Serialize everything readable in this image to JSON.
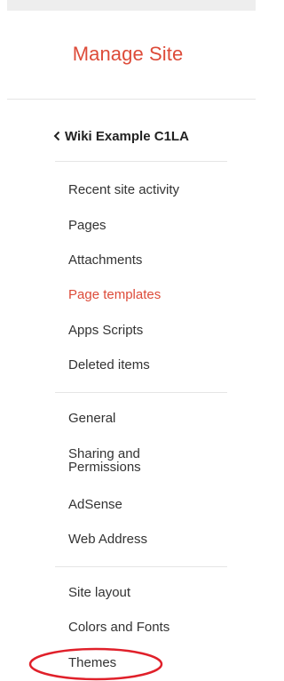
{
  "header": {
    "title": "Manage Site"
  },
  "site": {
    "back_label": "Wiki Example C1LA"
  },
  "nav_groups": {
    "content": [
      "Recent site activity",
      "Pages",
      "Attachments",
      "Page templates",
      "Apps Scripts",
      "Deleted items"
    ],
    "settings": [
      "General",
      "Sharing and Permissions",
      "AdSense",
      "Web Address"
    ],
    "appearance": [
      "Site layout",
      "Colors and Fonts",
      "Themes"
    ]
  },
  "active_item": "Page templates",
  "colors": {
    "accent": "#dd4b39",
    "annotation": "#e0202a",
    "text": "#333333"
  },
  "icons": {
    "back": "chevron-left-icon"
  }
}
